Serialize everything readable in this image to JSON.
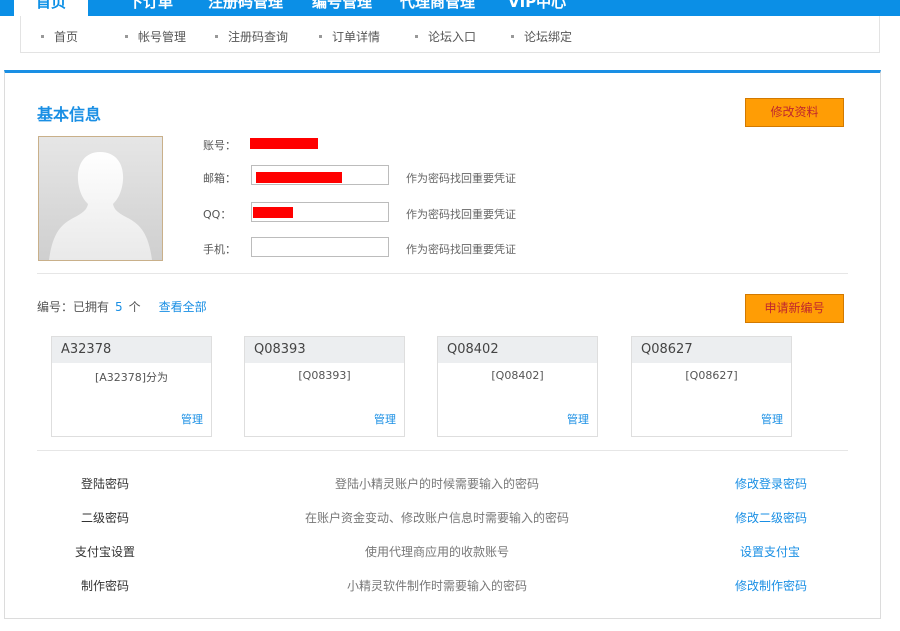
{
  "top_nav": {
    "tabs": [
      "首页",
      "下订单",
      "注册码管理",
      "编号管理",
      "代理商管理",
      "VIP中心"
    ]
  },
  "sub_nav": {
    "items": [
      "首页",
      "帐号管理",
      "注册码查询",
      "订单详情",
      "论坛入口",
      "论坛绑定"
    ]
  },
  "basic_info": {
    "title": "基本信息",
    "edit_button": "修改资料",
    "fields": {
      "account_label": "账号：",
      "email_label": "邮箱：",
      "email_hint": "作为密码找回重要凭证",
      "qq_label": "QQ：",
      "qq_hint": "作为密码找回重要凭证",
      "phone_label": "手机：",
      "phone_hint": "作为密码找回重要凭证"
    }
  },
  "codes": {
    "prefix": "编号：已拥有",
    "count": "5",
    "suffix": "个",
    "view_all": "查看全部",
    "apply_button": "申请新编号",
    "cards": [
      {
        "id": "A32378",
        "desc": "[A32378]分为",
        "manage": "管理"
      },
      {
        "id": "Q08393",
        "desc": "[Q08393]",
        "manage": "管理"
      },
      {
        "id": "Q08402",
        "desc": "[Q08402]",
        "manage": "管理"
      },
      {
        "id": "Q08627",
        "desc": "[Q08627]",
        "manage": "管理"
      }
    ]
  },
  "passwords": [
    {
      "name": "登陆密码",
      "desc": "登陆小精灵账户的时候需要输入的密码",
      "action": "修改登录密码"
    },
    {
      "name": "二级密码",
      "desc": "在账户资金变动、修改账户信息时需要输入的密码",
      "action": "修改二级密码"
    },
    {
      "name": "支付宝设置",
      "desc": "使用代理商应用的收款账号",
      "action": "设置支付宝"
    },
    {
      "name": "制作密码",
      "desc": "小精灵软件制作时需要输入的密码",
      "action": "修改制作密码"
    }
  ],
  "colors": {
    "primary": "#1a8fe4",
    "nav_blue": "#0b8fe6",
    "orange_button": "#ff9d05",
    "redaction": "#ff0000"
  }
}
